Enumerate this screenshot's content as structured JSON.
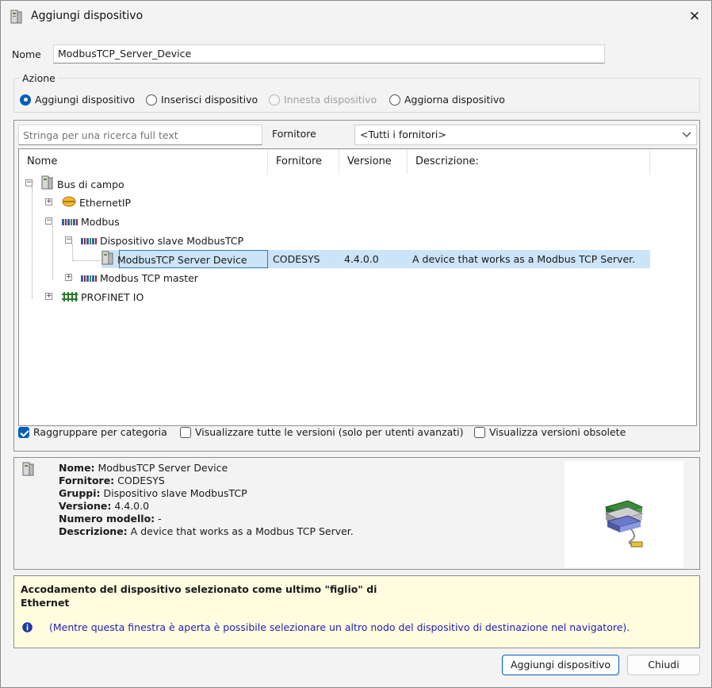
{
  "window": {
    "title": "Aggiungi dispositivo",
    "close_glyph": "✕"
  },
  "name_field": {
    "label": "Nome",
    "value": "ModbusTCP_Server_Device"
  },
  "action_group": {
    "title": "Azione",
    "options": [
      {
        "label": "Aggiungi dispositivo",
        "checked": true,
        "enabled": true
      },
      {
        "label": "Inserisci dispositivo",
        "checked": false,
        "enabled": true
      },
      {
        "label": "Innesta dispositivo",
        "checked": false,
        "enabled": false
      },
      {
        "label": "Aggiorna dispositivo",
        "checked": false,
        "enabled": true
      }
    ]
  },
  "search": {
    "placeholder": "Stringa per una ricerca full text"
  },
  "vendor_filter": {
    "label": "Fornitore",
    "selected": "<Tutti i fornitori>"
  },
  "tree": {
    "columns": [
      "Nome",
      "Fornitore",
      "Versione",
      "Descrizione:"
    ],
    "nodes": [
      {
        "label": "Bus di campo",
        "icon": "device-icon",
        "expander": "−"
      },
      {
        "label": "EthernetIP",
        "icon": "ethernetip-icon",
        "expander": "+"
      },
      {
        "label": "Modbus",
        "icon": "modbus-icon",
        "expander": "−"
      },
      {
        "label": "Dispositivo slave ModbusTCP",
        "icon": "modbus-icon",
        "expander": "−"
      },
      {
        "label": "ModbusTCP Server Device",
        "icon": "device-icon",
        "vendor": "CODESYS",
        "version": "4.4.0.0",
        "description": "A device that works as a Modbus TCP Server.",
        "selected": true
      },
      {
        "label": "Modbus TCP master",
        "icon": "modbus-icon",
        "expander": "+"
      },
      {
        "label": "PROFINET IO",
        "icon": "profinet-icon",
        "expander": "+"
      }
    ]
  },
  "options": [
    {
      "label": "Raggruppare per categoria",
      "checked": true
    },
    {
      "label": "Visualizzare tutte le versioni (solo per utenti avanzati)",
      "checked": false
    },
    {
      "label": "Visualizza versioni obsolete",
      "checked": false
    }
  ],
  "details": {
    "name_label": "Nome:",
    "name_value": "ModbusTCP Server Device",
    "vendor_label": "Fornitore:",
    "vendor_value": "CODESYS",
    "groups_label": "Gruppi:",
    "groups_value": "Dispositivo slave ModbusTCP",
    "version_label": "Versione:",
    "version_value": "4.4.0.0",
    "model_label": "Numero modello:",
    "model_value": "-",
    "desc_label": "Descrizione:",
    "desc_value": "A device that works as a Modbus TCP Server."
  },
  "note": {
    "line1": "Accodamento del dispositivo selezionato come ultimo \"figlio\" di",
    "line2": "Ethernet",
    "info": "(Mentre questa finestra è aperta è possibile selezionare un altro nodo del dispositivo di destinazione nel navigatore)."
  },
  "buttons": {
    "add": "Aggiungi dispositivo",
    "close": "Chiudi"
  },
  "colors": {
    "accent": "#005fb8",
    "selection": "#cce4f7",
    "note_bg": "#fffce0",
    "info_text": "#1f1fb0"
  }
}
